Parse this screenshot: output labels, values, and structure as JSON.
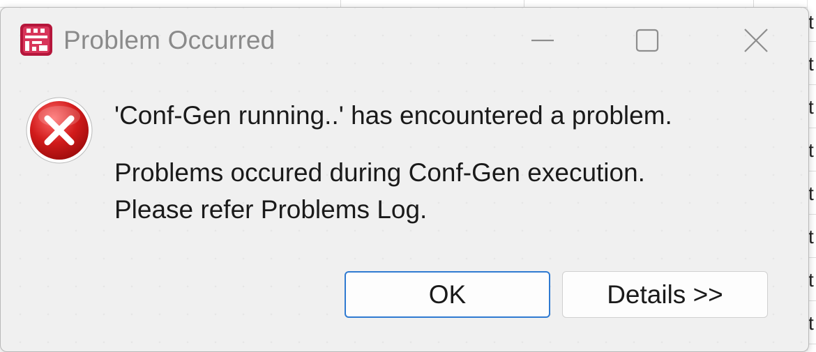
{
  "window": {
    "title": "Problem Occurred"
  },
  "dialog": {
    "main_message": "'Conf-Gen running..' has encountered a problem.",
    "detail_lines": [
      "Problems occured during Conf-Gen execution.",
      "Please refer Problems Log."
    ],
    "buttons": {
      "ok_label": "OK",
      "details_label": "Details >>"
    }
  },
  "background": {
    "right_strip_chars": [
      "t",
      "t",
      "t",
      "t",
      "t",
      "t",
      "t",
      "t"
    ]
  },
  "icons": {
    "app": "app-icon",
    "minimize": "minimize-icon",
    "maximize": "maximize-icon",
    "close": "close-icon",
    "error": "error-icon"
  },
  "colors": {
    "dialog_bg": "#f0f0f0",
    "title_text": "#8a8a8a",
    "ok_border": "#2f7ad1",
    "error_red": "#d11b1b",
    "app_icon": "#b5163b"
  }
}
